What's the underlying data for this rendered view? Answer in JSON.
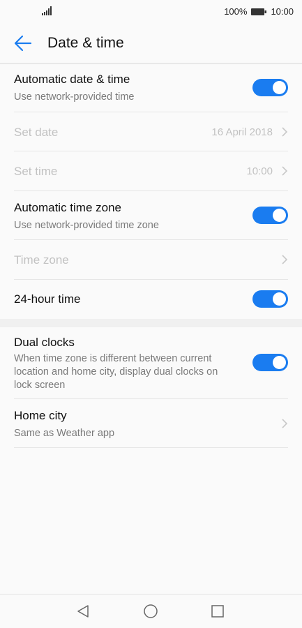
{
  "status_bar": {
    "battery_percent": "100%",
    "time": "10:00",
    "icons": [
      "signal-icon",
      "battery-icon"
    ]
  },
  "header": {
    "title": "Date & time",
    "back_icon": "back-arrow-icon"
  },
  "settings": {
    "auto_datetime": {
      "title": "Automatic date & time",
      "subtitle": "Use network-provided time",
      "enabled": true
    },
    "set_date": {
      "title": "Set date",
      "value": "16 April 2018"
    },
    "set_time": {
      "title": "Set time",
      "value": "10:00"
    },
    "auto_timezone": {
      "title": "Automatic time zone",
      "subtitle": "Use network-provided time zone",
      "enabled": true
    },
    "time_zone": {
      "title": "Time zone"
    },
    "hour_24": {
      "title": "24-hour time",
      "enabled": true
    },
    "dual_clocks": {
      "title": "Dual clocks",
      "subtitle": "When time zone is different between current location and home city, display dual clocks on lock screen",
      "enabled": true
    },
    "home_city": {
      "title": "Home city",
      "subtitle": "Same as Weather app"
    }
  },
  "nav": {
    "icons": [
      "back-triangle-icon",
      "home-circle-icon",
      "recents-square-icon"
    ]
  },
  "colors": {
    "accent": "#1a7cf0",
    "disabled_text": "#c2c2c2",
    "secondary_text": "#7a7a7a"
  }
}
